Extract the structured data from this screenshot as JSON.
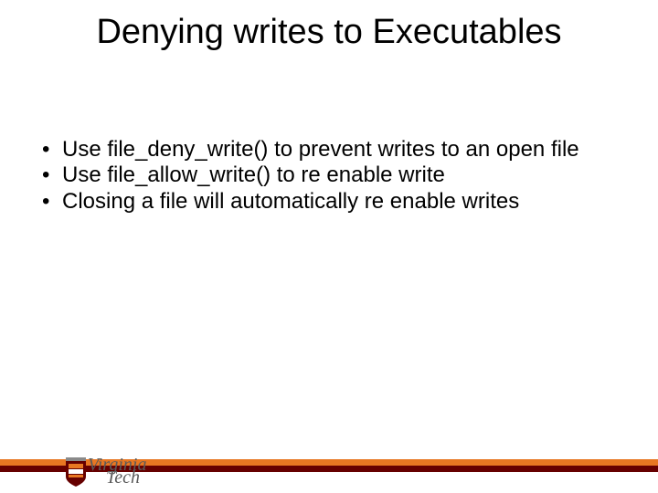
{
  "title": "Denying writes to Executables",
  "bullets": [
    "Use file_deny_write() to prevent writes to an open file",
    "Use file_allow_write() to re enable write",
    "Closing a file will automatically re enable writes"
  ],
  "logo": {
    "line1": "Virginia",
    "line2": "Tech"
  },
  "colors": {
    "orange": "#e87722",
    "maroon": "#660000"
  }
}
